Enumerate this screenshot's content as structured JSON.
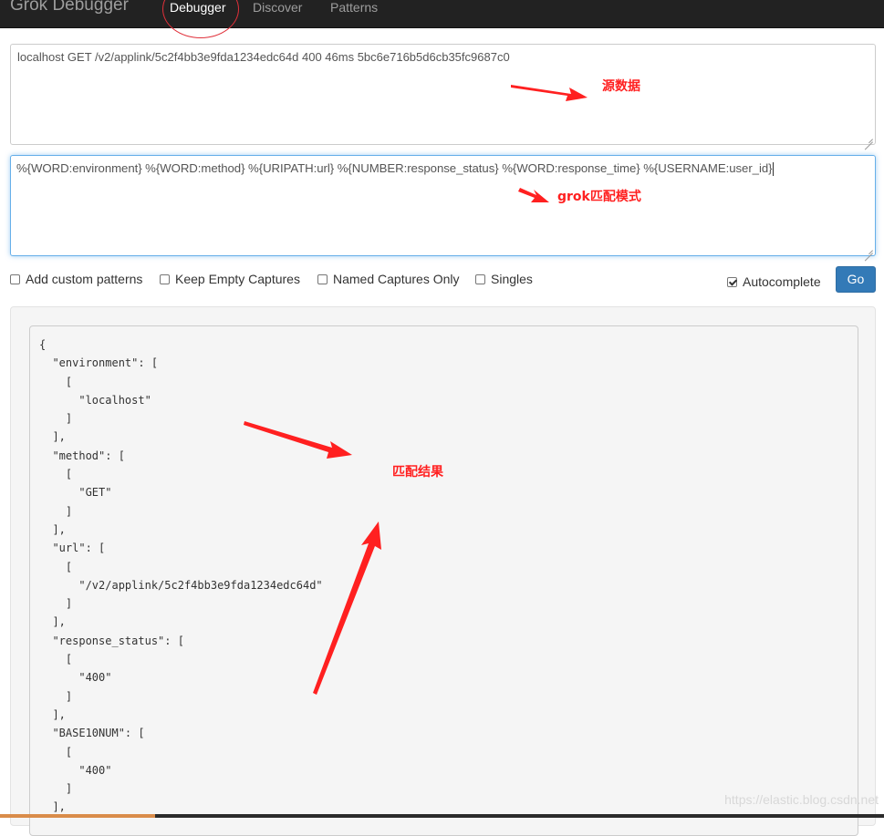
{
  "navbar": {
    "brand": "Grok Debugger",
    "tabs": [
      {
        "label": "Debugger",
        "active": true
      },
      {
        "label": "Discover",
        "active": false
      },
      {
        "label": "Patterns",
        "active": false
      }
    ]
  },
  "input": {
    "sample_data": "localhost GET /v2/applink/5c2f4bb3e9fda1234edc64d 400 46ms 5bc6e716b5d6cb35fc9687c0",
    "grok_pattern": "%{WORD:environment} %{WORD:method} %{URIPATH:url} %{NUMBER:response_status} %{WORD:response_time} %{USERNAME:user_id}"
  },
  "options": {
    "add_custom_patterns": {
      "label": "Add custom patterns",
      "checked": false
    },
    "keep_empty_captures": {
      "label": "Keep Empty Captures",
      "checked": false
    },
    "named_captures_only": {
      "label": "Named Captures Only",
      "checked": false
    },
    "singles": {
      "label": "Singles",
      "checked": false
    },
    "autocomplete": {
      "label": "Autocomplete",
      "checked": true
    },
    "go_label": "Go"
  },
  "output": {
    "lines": [
      "{",
      "  \"environment\": [",
      "    [",
      "      \"localhost\"",
      "    ]",
      "  ],",
      "  \"method\": [",
      "    [",
      "      \"GET\"",
      "    ]",
      "  ],",
      "  \"url\": [",
      "    [",
      "      \"/v2/applink/5c2f4bb3e9fda1234edc64d\"",
      "    ]",
      "  ],",
      "  \"response_status\": [",
      "    [",
      "      \"400\"",
      "    ]",
      "  ],",
      "  \"BASE10NUM\": [",
      "    [",
      "      \"400\"",
      "    ]",
      "  ],"
    ]
  },
  "annotations": {
    "source_data": "源数据",
    "grok_pattern": "grok匹配模式",
    "match_result": "匹配结果",
    "color": "#ff2020"
  },
  "watermark": "https://elastic.blog.csdn.net"
}
